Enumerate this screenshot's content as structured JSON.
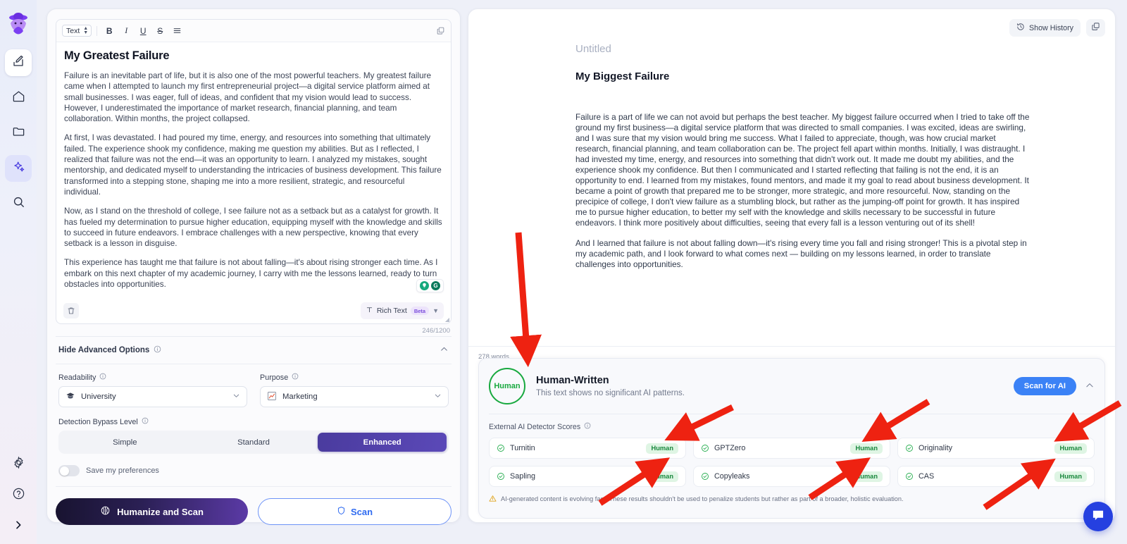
{
  "rail": {
    "logo_icon": "detective-avatar-logo",
    "items": [
      {
        "name": "editor",
        "icon": "pencil-square-icon",
        "active_white": true
      },
      {
        "name": "home",
        "icon": "home-icon"
      },
      {
        "name": "files",
        "icon": "folder-icon"
      },
      {
        "name": "ai-humanizer",
        "icon": "sparkles-icon",
        "active": true
      },
      {
        "name": "search",
        "icon": "search-icon"
      }
    ],
    "bottom_items": [
      {
        "name": "settings",
        "icon": "gear-icon"
      },
      {
        "name": "help",
        "icon": "question-circle-icon"
      },
      {
        "name": "expand",
        "icon": "chevron-right-icon"
      }
    ]
  },
  "editor": {
    "toolbar": {
      "style_select": "Text",
      "bold": "B",
      "italic": "I",
      "underline": "U",
      "strikethrough": "S",
      "list_icon": "bullet-list-icon",
      "expand_icon": "expand-panel-icon"
    },
    "title": "My Greatest Failure",
    "paragraphs": [
      "Failure is an inevitable part of life, but it is also one of the most powerful teachers. My greatest failure came when I attempted to launch my first entrepreneurial project—a digital service platform aimed at small businesses. I was eager, full of ideas, and confident that my vision would lead to success. However, I underestimated the importance of market research, financial planning, and team collaboration. Within months, the project collapsed.",
      "At first, I was devastated. I had poured my time, energy, and resources into something that ultimately failed. The experience shook my confidence, making me question my abilities. But as I reflected, I realized that failure was not the end—it was an opportunity to learn. I analyzed my mistakes, sought mentorship, and dedicated myself to understanding the intricacies of business development. This failure transformed into a stepping stone, shaping me into a more resilient, strategic, and resourceful individual.",
      "Now, as I stand on the threshold of college, I see failure not as a setback but as a catalyst for growth. It has fueled my determination to pursue higher education, equipping myself with the knowledge and skills to succeed in future endeavors. I embrace challenges with a new perspective, knowing that every setback is a lesson in disguise.",
      "This experience has taught me that failure is not about falling—it's about rising stronger each time. As I embark on this next chapter of my academic journey, I carry with me the lessons learned, ready to turn obstacles into opportunities."
    ],
    "grammarly_icons": [
      "lightbulb-icon",
      "grammarly-g-icon"
    ],
    "footer": {
      "delete_icon": "trash-icon",
      "format_icon": "text-format-icon",
      "format_label": "Rich Text",
      "beta_badge": "Beta",
      "resize_icon": "resize-grip-icon"
    },
    "char_count": "246/1200"
  },
  "advanced": {
    "header_label": "Hide Advanced Options",
    "header_info_icon": "info-icon",
    "collapse_icon": "chevron-up-icon",
    "readability": {
      "label": "Readability",
      "info_icon": "info-icon",
      "value": "University",
      "value_icon": "graduation-cap-icon",
      "chevron": "chevron-down-icon"
    },
    "purpose": {
      "label": "Purpose",
      "info_icon": "info-icon",
      "value": "Marketing",
      "value_icon": "chart-line-icon",
      "chevron": "chevron-down-icon"
    },
    "bypass": {
      "label": "Detection Bypass Level",
      "info_icon": "info-icon",
      "options": [
        "Simple",
        "Standard",
        "Enhanced"
      ],
      "selected": "Enhanced"
    },
    "save_prefs": {
      "label": "Save my preferences",
      "on": false
    }
  },
  "actions": {
    "primary_label": "Humanize and Scan",
    "primary_icon": "brain-icon",
    "secondary_label": "Scan",
    "secondary_icon": "shield-icon"
  },
  "output": {
    "show_history_label": "Show History",
    "show_history_icon": "clock-history-icon",
    "copy_icon": "copy-icon",
    "untitled": "Untitled",
    "title": "My Biggest Failure",
    "paragraphs": [
      "Failure is a  part of life we can not avoid but perhaps the best teacher. My biggest failure occurred when I tried  to take off the ground my first business—a digital service platform that was directed to small companies. I was excited, ideas are swirling, and I was sure that my vision would bring me success. What I failed to appreciate, though, was how crucial market research, financial planning, and team  collaboration can be. The  project fell apart within months. Initially,  I  was distraught.  I  had invested my time, energy, and resources into something that didn't work out. It made me doubt my abilities, and the  experience shook my confidence. But then I communicated and I started reflecting  that failing is not the end, it is an opportunity to end. I learned from my mistakes, found mentors, and made it my goal to read about business  development. It became a point of growth that prepared me to be stronger, more strategic,  and more resourceful. Now, standing on the precipice of college, I don't view failure as a stumbling block, but rather as the jumping-off point for  growth. It has inspired me to pursue higher  education, to better my self with the knowledge and skills necessary to be successful in future endeavors. I think more positively about difficulties, seeing that every fall is a lesson venturing out of  its shell!",
      "And I learned that failure is not about falling down—it's rising every time you  fall and rising stronger! This is a pivotal step in my academic path, and I look forward to what comes next — building on my lessons learned, in order  to translate challenges into opportunities."
    ],
    "word_count": "278 words"
  },
  "results": {
    "badge_label": "Human",
    "title": "Human-Written",
    "subtitle": "This text shows no significant AI patterns.",
    "scan_button_label": "Scan for AI",
    "collapse_icon": "chevron-up-icon",
    "external_label": "External AI Detector Scores",
    "external_info_icon": "info-icon",
    "detectors": [
      {
        "name": "Turnitin",
        "verdict": "Human",
        "icon": "check-circle-icon"
      },
      {
        "name": "GPTZero",
        "verdict": "Human",
        "icon": "check-circle-icon"
      },
      {
        "name": "Originality",
        "verdict": "Human",
        "icon": "check-circle-icon"
      },
      {
        "name": "Sapling",
        "verdict": "Human",
        "icon": "check-circle-icon"
      },
      {
        "name": "Copyleaks",
        "verdict": "Human",
        "icon": "check-circle-icon"
      },
      {
        "name": "CAS",
        "verdict": "Human",
        "icon": "check-circle-icon"
      }
    ],
    "disclaimer_icon": "warning-triangle-icon",
    "disclaimer": "AI-generated content is evolving fast. These results shouldn't be used to penalize students but rather as part of a broader, holistic evaluation."
  },
  "chat": {
    "icon": "chat-bubble-icon"
  },
  "colors": {
    "accent_purple": "#4b3ee0",
    "scan_blue": "#3b82f6",
    "human_green": "#18a93f",
    "badge_green_bg": "#dff5e4",
    "annotation_red": "#ee2211"
  }
}
